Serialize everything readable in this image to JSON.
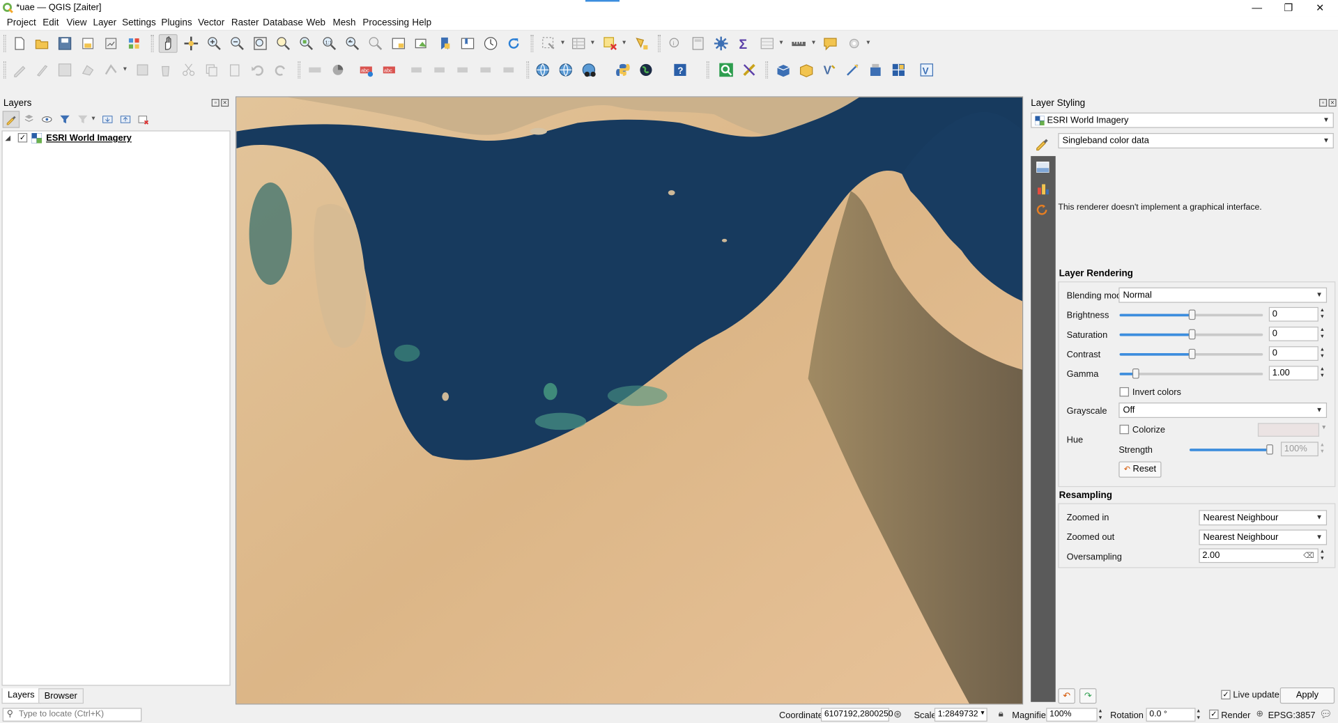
{
  "window": {
    "title": "*uae — QGIS [Zaiter]",
    "minimize": "—",
    "restore": "❐",
    "close": "✕"
  },
  "menu": [
    "Project",
    "Edit",
    "View",
    "Layer",
    "Settings",
    "Plugins",
    "Vector",
    "Raster",
    "Database",
    "Web",
    "Mesh",
    "Processing",
    "Help"
  ],
  "layers_panel": {
    "title": "Layers",
    "layer_name": "ESRI World Imagery",
    "layer_checked": true,
    "tabs": [
      "Layers",
      "Browser"
    ]
  },
  "styling_panel": {
    "title": "Layer Styling",
    "layer_select": "ESRI World Imagery",
    "renderer_select": "Singleband color data",
    "renderer_message": "This renderer doesn't implement a graphical interface.",
    "layer_rendering": {
      "heading": "Layer Rendering",
      "blending_label": "Blending mode",
      "blending_value": "Normal",
      "brightness_label": "Brightness",
      "brightness_value": "0",
      "saturation_label": "Saturation",
      "saturation_value": "0",
      "contrast_label": "Contrast",
      "contrast_value": "0",
      "gamma_label": "Gamma",
      "gamma_value": "1.00",
      "invert_label": "Invert colors",
      "grayscale_label": "Grayscale",
      "grayscale_value": "Off",
      "hue_label": "Hue",
      "colorize_label": "Colorize",
      "strength_label": "Strength",
      "strength_value": "100%",
      "reset_label": "Reset"
    },
    "resampling": {
      "heading": "Resampling",
      "zoomed_in_label": "Zoomed in",
      "zoomed_in_value": "Nearest Neighbour",
      "zoomed_out_label": "Zoomed out",
      "zoomed_out_value": "Nearest Neighbour",
      "oversampling_label": "Oversampling",
      "oversampling_value": "2.00"
    },
    "live_update_label": "Live update",
    "live_update_checked": true,
    "apply_label": "Apply"
  },
  "statusbar": {
    "locate_placeholder": "Type to locate (Ctrl+K)",
    "coordinate_label": "Coordinate",
    "coordinate_value": "6107192,2800250",
    "scale_label": "Scale",
    "scale_value": "1:2849732",
    "magnifier_label": "Magnifier",
    "magnifier_value": "100%",
    "rotation_label": "Rotation",
    "rotation_value": "0.0 °",
    "render_label": "Render",
    "crs_label": "EPSG:3857"
  },
  "colors": {
    "sea": "#173a5e",
    "desert": "#dcb687",
    "mountains": "#8a7656",
    "accent": "#3c8dde"
  }
}
